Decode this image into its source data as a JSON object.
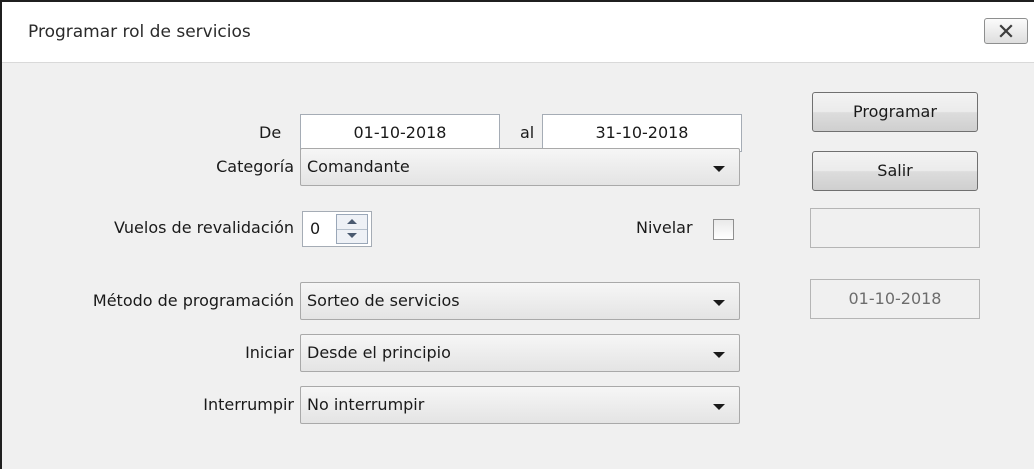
{
  "window": {
    "title": "Programar rol de servicios",
    "close_icon": "close-icon"
  },
  "dates": {
    "from_label": "De",
    "from_value": "01-10-2018",
    "to_label": "al",
    "to_value": "31-10-2018"
  },
  "categoria": {
    "label": "Categoría",
    "value": "Comandante"
  },
  "vuelos": {
    "label": "Vuelos de revalidación",
    "value": "0"
  },
  "nivelar": {
    "label": "Nivelar",
    "checked": false
  },
  "metodo": {
    "label": "Método de programación",
    "value": "Sorteo de servicios"
  },
  "iniciar": {
    "label": "Iniciar",
    "value": "Desde el principio"
  },
  "interrumpir": {
    "label": "Interrumpir",
    "value": "No interrumpir"
  },
  "buttons": {
    "programar": "Programar",
    "salir": "Salir"
  },
  "side": {
    "empty_value": "",
    "date_value": "01-10-2018"
  }
}
